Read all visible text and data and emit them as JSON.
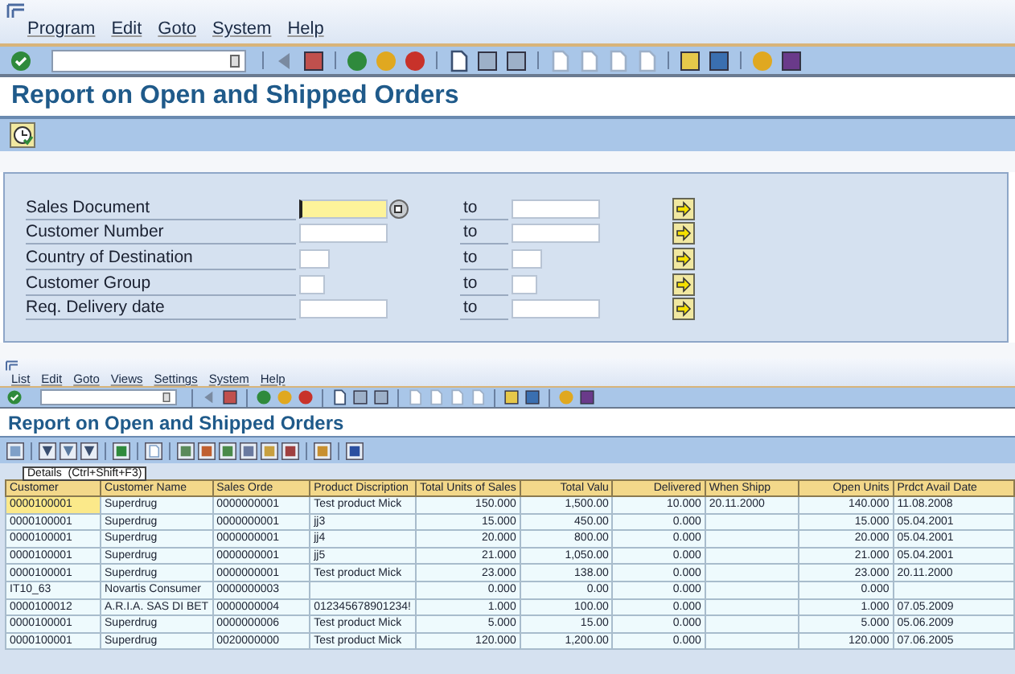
{
  "top_window": {
    "menu": [
      "Program",
      "Edit",
      "Goto",
      "System",
      "Help"
    ],
    "title": "Report on Open and Shipped Orders",
    "selection": [
      {
        "label": "Sales Document",
        "to_label": "to",
        "focused": true
      },
      {
        "label": "Customer Number",
        "to_label": "to",
        "focused": false
      },
      {
        "label": "Country of Destination",
        "to_label": "to",
        "focused": false
      },
      {
        "label": "Customer Group",
        "to_label": "to",
        "focused": false
      },
      {
        "label": "Req. Delivery date",
        "to_label": "to",
        "focused": false
      }
    ]
  },
  "list_window": {
    "menu": [
      "List",
      "Edit",
      "Goto",
      "Views",
      "Settings",
      "System",
      "Help"
    ],
    "title": "Report on Open and Shipped Orders",
    "tooltip": "Details  (Ctrl+Shift+F3)",
    "table": {
      "columns": [
        {
          "label": "Customer"
        },
        {
          "label": "Customer Name"
        },
        {
          "label": "Sales Orde"
        },
        {
          "label": "Product Discription"
        },
        {
          "label": "Total Units of Sales"
        },
        {
          "label": "Total Valu"
        },
        {
          "label": "Delivered"
        },
        {
          "label": "When Shipp"
        },
        {
          "label": "Open Units"
        },
        {
          "label": "Prdct Avail Date"
        }
      ],
      "rows": [
        {
          "selected": true,
          "cells": [
            "0000100001",
            "Superdrug",
            "0000000001",
            "Test product  Mick",
            "150.000",
            "1,500.00",
            "10.000",
            "20.11.2000",
            "140.000",
            "11.08.2008"
          ]
        },
        {
          "selected": false,
          "cells": [
            "0000100001",
            "Superdrug",
            "0000000001",
            "jj3",
            "15.000",
            "450.00",
            "0.000",
            null,
            "15.000",
            "05.04.2001"
          ]
        },
        {
          "selected": false,
          "cells": [
            "0000100001",
            "Superdrug",
            "0000000001",
            "jj4",
            "20.000",
            "800.00",
            "0.000",
            null,
            "20.000",
            "05.04.2001"
          ]
        },
        {
          "selected": false,
          "cells": [
            "0000100001",
            "Superdrug",
            "0000000001",
            "jj5",
            "21.000",
            "1,050.00",
            "0.000",
            null,
            "21.000",
            "05.04.2001"
          ]
        },
        {
          "selected": false,
          "cells": [
            "0000100001",
            "Superdrug",
            "0000000001",
            "Test product  Mick",
            "23.000",
            "138.00",
            "0.000",
            null,
            "23.000",
            "20.11.2000"
          ]
        },
        {
          "selected": false,
          "cells": [
            "IT10_63",
            "Novartis Consumer",
            "0000000003",
            null,
            "0.000",
            "0.00",
            "0.000",
            null,
            "0.000",
            null
          ]
        },
        {
          "selected": false,
          "cells": [
            "0000100012",
            "A.R.I.A. SAS DI BET",
            "0000000004",
            "012345678901234!",
            "1.000",
            "100.00",
            "0.000",
            null,
            "1.000",
            "07.05.2009"
          ]
        },
        {
          "selected": false,
          "cells": [
            "0000100001",
            "Superdrug",
            "0000000006",
            "Test product  Mick",
            "5.000",
            "15.00",
            "0.000",
            null,
            "5.000",
            "05.06.2009"
          ]
        },
        {
          "selected": false,
          "cells": [
            "0000100001",
            "Superdrug",
            "0020000000",
            "Test product  Mick",
            "120.000",
            "1,200.00",
            "0.000",
            null,
            "120.000",
            "07.06.2005"
          ]
        }
      ]
    }
  }
}
